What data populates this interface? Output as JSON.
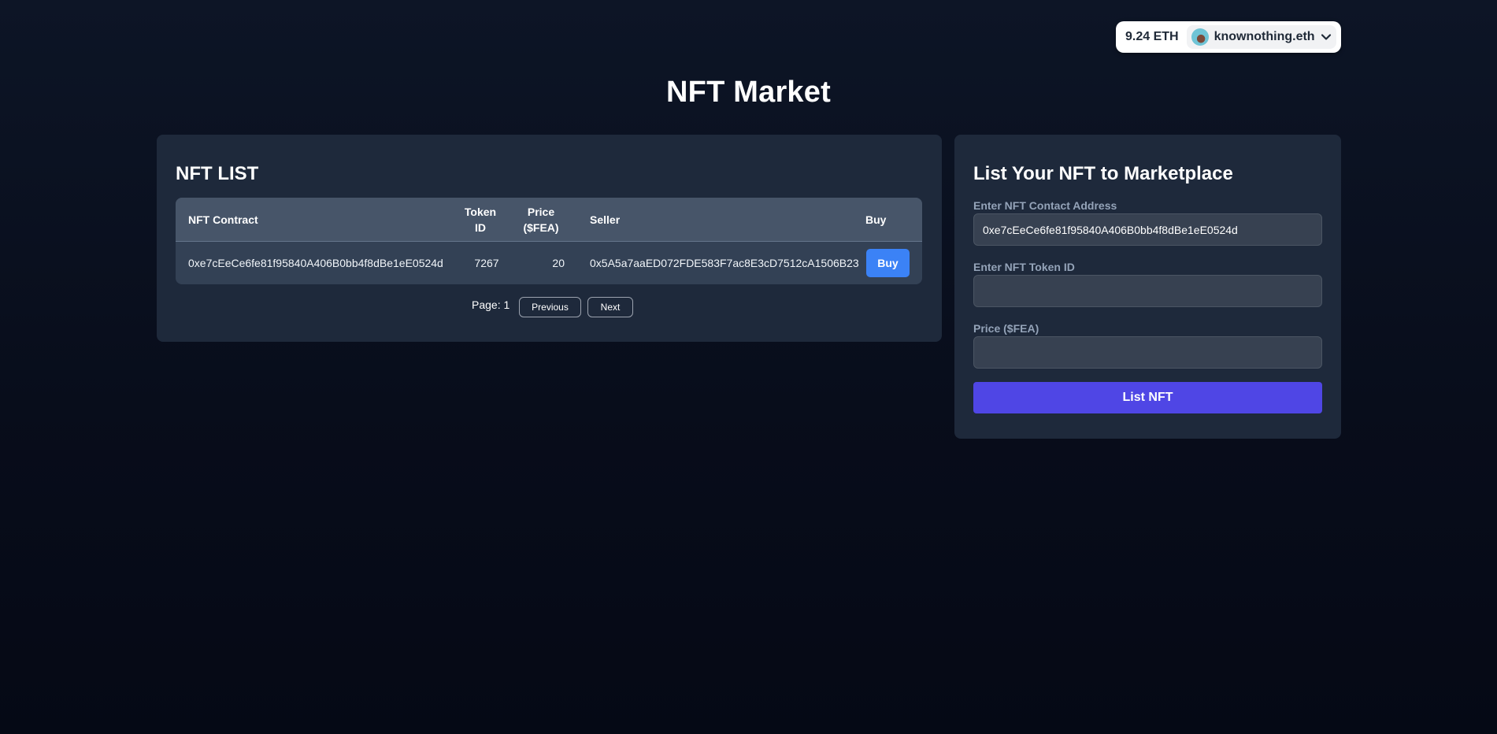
{
  "wallet": {
    "balance": "9.24 ETH",
    "ens_name": "knownothing.eth"
  },
  "page": {
    "title": "NFT Market"
  },
  "nft_list": {
    "heading": "NFT LIST",
    "columns": {
      "contract": "NFT Contract",
      "token_id": "Token ID",
      "price": "Price ($FEA)",
      "seller": "Seller",
      "buy": "Buy"
    },
    "rows": [
      {
        "contract": "0xe7cEeCe6fe81f95840A406B0bb4f8dBe1eE0524d",
        "token_id": "7267",
        "price": "20",
        "seller": "0x5A5a7aaED072FDE583F7ac8E3cD7512cA1506B23",
        "buy_label": "Buy"
      }
    ],
    "pagination": {
      "page_label": "Page: 1",
      "previous_label": "Previous",
      "next_label": "Next"
    }
  },
  "list_form": {
    "heading": "List Your NFT to Marketplace",
    "contract_label": "Enter NFT Contact Address",
    "contract_value": "0xe7cEeCe6fe81f95840A406B0bb4f8dBe1eE0524d",
    "token_label": "Enter NFT Token ID",
    "token_value": "",
    "price_label": "Price ($FEA)",
    "price_value": "",
    "submit_label": "List NFT"
  },
  "colors": {
    "background": "#0b1222",
    "panel": "#1e293b",
    "buy_button": "#3b82f6",
    "list_button": "#4f46e5"
  },
  "icons": {
    "wallet_dropdown": "chevron-down-icon",
    "account_avatar": "avatar"
  }
}
